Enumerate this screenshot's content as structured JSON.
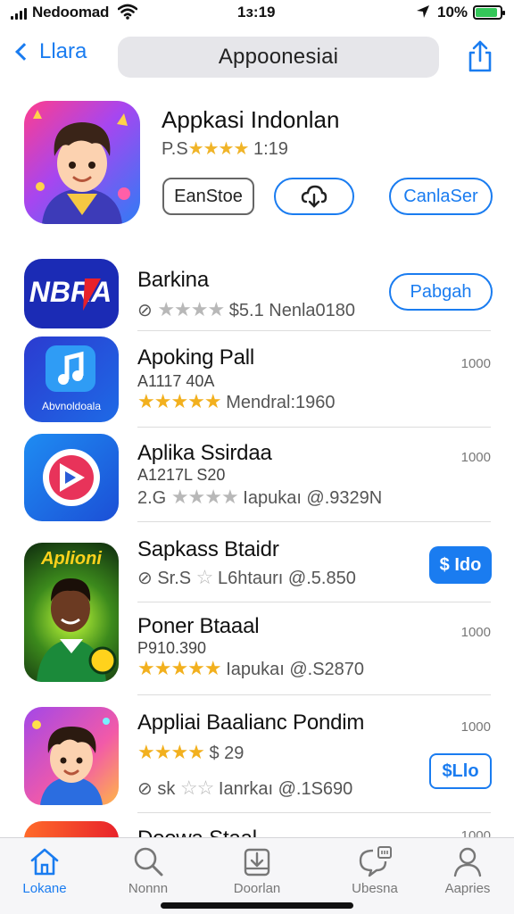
{
  "status_bar": {
    "carrier": "Nedoomad",
    "time": "1з:19",
    "battery": "10%",
    "battery_level": 0.9,
    "battery_color": "#34c759"
  },
  "nav": {
    "back_label": "Llara",
    "search_text": "Appoonesiai",
    "share_icon": "share-icon"
  },
  "featured": {
    "title": "Appkasi Indonlan",
    "rating_prefix": "P.S",
    "stars": "★★★★",
    "rating_suffix": "1:19",
    "buttons": [
      "EanStoe",
      "",
      "CanlaSer"
    ]
  },
  "apps": [
    {
      "name": "Barkina",
      "subtitle": "",
      "meta_prefix": "⊘",
      "stars": "★★★★",
      "stars_filled": false,
      "meta": "$5.1 Nenla0180",
      "action": "Pabgah",
      "action_style": "outline",
      "count": ""
    },
    {
      "name": "Apoking Pall",
      "subtitle": "A1117 40A",
      "meta_prefix": "",
      "stars": "★★★★★",
      "stars_filled": true,
      "meta": "Mendral:1960",
      "action": "",
      "action_style": "",
      "count": "1000"
    },
    {
      "name": "Aplika Ssirdaa",
      "subtitle": "A1217L S20",
      "meta_prefix": "2.G",
      "stars": "★★★★",
      "stars_filled": false,
      "meta": "Iapukaı @.9329N",
      "action": "",
      "action_style": "",
      "count": "1000"
    },
    {
      "name": "Sapkass Btaidr",
      "subtitle": "",
      "meta_prefix": "⊘ Sr.S",
      "stars": "☆",
      "stars_filled": false,
      "meta": "L6htaurı @.5.850",
      "action": "$ Ido",
      "action_style": "solid",
      "count": ""
    },
    {
      "name": "Poner Btaaal",
      "subtitle": "P910.390",
      "meta_prefix": "",
      "stars": "★★★★★",
      "stars_filled": true,
      "meta": "Iapukaı @.S2870",
      "action": "",
      "action_style": "",
      "count": "1000"
    },
    {
      "name": "Appliai Baalianc Pondim",
      "subtitle": "",
      "meta_prefix": "",
      "stars": "★★★★",
      "stars_filled": true,
      "meta": "$ 29",
      "meta2_prefix": "⊘ sk",
      "meta2": "Ianrkaı @.1S690",
      "action": "$Llo",
      "action_style": "square",
      "count": "1000"
    },
    {
      "name": "Doowa Staal",
      "subtitle": "",
      "count": "1000"
    }
  ],
  "featured_icon_text": "",
  "app_icon_texts": [
    "NBRA",
    "Abvnoldoala",
    "",
    "Aplioni"
  ],
  "tabs": [
    {
      "label": "Lokane",
      "icon": "home-icon",
      "active": true
    },
    {
      "label": "Nonnn",
      "icon": "search-icon",
      "active": false
    },
    {
      "label": "Doorlan",
      "icon": "download-icon",
      "active": false
    },
    {
      "label": "Ubesna",
      "icon": "chat-icon",
      "active": false
    },
    {
      "label": "Aapries",
      "icon": "profile-icon",
      "active": false
    }
  ],
  "colors": {
    "accent": "#1a7cf0",
    "star": "#f2b01e"
  }
}
